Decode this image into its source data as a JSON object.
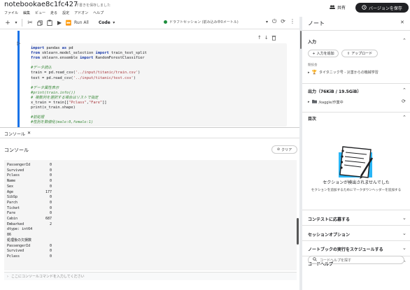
{
  "header": {
    "title": "notebookae8c1fc427",
    "saved_note": "下書きを保存しました",
    "menu": [
      "ファイル",
      "編集",
      "ビュー",
      "走る",
      "設定",
      "アドオン",
      "ヘルプ"
    ],
    "share_label": "共有",
    "save_version_label": "バージョンを保存"
  },
  "toolbar": {
    "run_all_label": "Run All",
    "cell_type": "Code",
    "session_text": "ドラフトセッション (前み込み中0メートル)",
    "icons": [
      "plus-icon",
      "scissors-icon",
      "copy-icon",
      "paste-icon",
      "play-icon",
      "fast-forward-icon",
      "chevron-down-icon",
      "power-icon",
      "refresh-icon",
      "more-icon"
    ]
  },
  "cell": {
    "lines": [
      {
        "segments": [
          {
            "t": "import",
            "c": "kw"
          },
          {
            "t": " pandas ",
            "c": ""
          },
          {
            "t": "as",
            "c": "kw"
          },
          {
            "t": " pd",
            "c": ""
          }
        ]
      },
      {
        "segments": [
          {
            "t": "from",
            "c": "kw"
          },
          {
            "t": " sklearn.model_selection ",
            "c": ""
          },
          {
            "t": "import",
            "c": "kw"
          },
          {
            "t": " train_test_split",
            "c": ""
          }
        ]
      },
      {
        "segments": [
          {
            "t": "from",
            "c": "kw"
          },
          {
            "t": " sklearn.ensemble ",
            "c": ""
          },
          {
            "t": "import",
            "c": "kw"
          },
          {
            "t": " RandomForestClassifier",
            "c": ""
          }
        ]
      },
      {
        "segments": [
          {
            "t": "",
            "c": ""
          }
        ]
      },
      {
        "segments": [
          {
            "t": "#データ読込",
            "c": "cm"
          }
        ]
      },
      {
        "segments": [
          {
            "t": "train = pd.read_csv(",
            "c": ""
          },
          {
            "t": "'../input/titanic/train.csv'",
            "c": "st"
          },
          {
            "t": ")",
            "c": ""
          }
        ]
      },
      {
        "segments": [
          {
            "t": "test = pd.read_csv(",
            "c": ""
          },
          {
            "t": "'../input/titanic/test.csv'",
            "c": "st"
          },
          {
            "t": ")",
            "c": ""
          }
        ]
      },
      {
        "segments": [
          {
            "t": "",
            "c": ""
          }
        ]
      },
      {
        "segments": [
          {
            "t": "#データ属性表示",
            "c": "cm"
          }
        ]
      },
      {
        "segments": [
          {
            "t": "#print(train.info())",
            "c": "cm"
          }
        ]
      },
      {
        "segments": [
          {
            "t": "# 複数列を選択する場合はリストで指定",
            "c": "cm"
          }
        ]
      },
      {
        "segments": [
          {
            "t": "x_train = train[[",
            "c": ""
          },
          {
            "t": "\"Pclass\"",
            "c": "st"
          },
          {
            "t": ",",
            "c": ""
          },
          {
            "t": "\"Fare\"",
            "c": "st"
          },
          {
            "t": "]]",
            "c": ""
          }
        ]
      },
      {
        "segments": [
          {
            "t": "print(x_train.shape)",
            "c": ""
          }
        ]
      },
      {
        "segments": [
          {
            "t": "",
            "c": ""
          }
        ]
      },
      {
        "segments": [
          {
            "t": "#前処理",
            "c": "cm"
          }
        ]
      },
      {
        "segments": [
          {
            "t": "#性別を数値化(male:0,female:1)",
            "c": "cm"
          }
        ]
      }
    ]
  },
  "console": {
    "tab_label": "コンソール",
    "heading": "コンソール",
    "clear_label": "クリア",
    "rows": [
      {
        "k": "PassengerId",
        "v": "0"
      },
      {
        "k": "Survived",
        "v": "0"
      },
      {
        "k": "Pclass",
        "v": "0"
      },
      {
        "k": "Name",
        "v": "0"
      },
      {
        "k": "Sex",
        "v": "0"
      },
      {
        "k": "Age",
        "v": "177"
      },
      {
        "k": "SibSp",
        "v": "0"
      },
      {
        "k": "Parch",
        "v": "0"
      },
      {
        "k": "Ticket",
        "v": "0"
      },
      {
        "k": "Fare",
        "v": "0"
      },
      {
        "k": "Cabin",
        "v": "687"
      },
      {
        "k": "Embarked",
        "v": "2"
      }
    ],
    "dtype_line": "dtype: int64",
    "value_line": "86",
    "after_heading": "処理後の欠損数",
    "rows2": [
      {
        "k": "PassengerId",
        "v": "0"
      },
      {
        "k": "Survived",
        "v": "0"
      },
      {
        "k": "Pclass",
        "v": "0"
      }
    ],
    "input_placeholder": "ここにコンソールコマンドを入力してください"
  },
  "right_panel": {
    "title": "ノート",
    "input_section": "入力",
    "add_input_label": "入力を追加",
    "upload_label": "アップロード",
    "competition_caption": "競技会",
    "competition_item": "タイタニック号 - 災害からの機械学習",
    "output_section": "出力（76KiB / 19.5GiB）",
    "output_path": "/kaggle/作業中",
    "toc_section": "目次",
    "toc_empty_title": "セクションが検出されませんでした",
    "toc_empty_body": "セクションを追加するためにマークダウンヘッダーを追加する",
    "submit_section": "コンテストに応募する",
    "session_options": "セッションオプション",
    "schedule_section": "ノートブックの実行をスケジュールする",
    "code_help_section": "コードヘルプ",
    "code_help_placeholder": "コードヘルプを探す"
  },
  "colors": {
    "accent": "#1a73e8",
    "dark_button": "#202124",
    "session_dot": "#1e8e3e"
  }
}
